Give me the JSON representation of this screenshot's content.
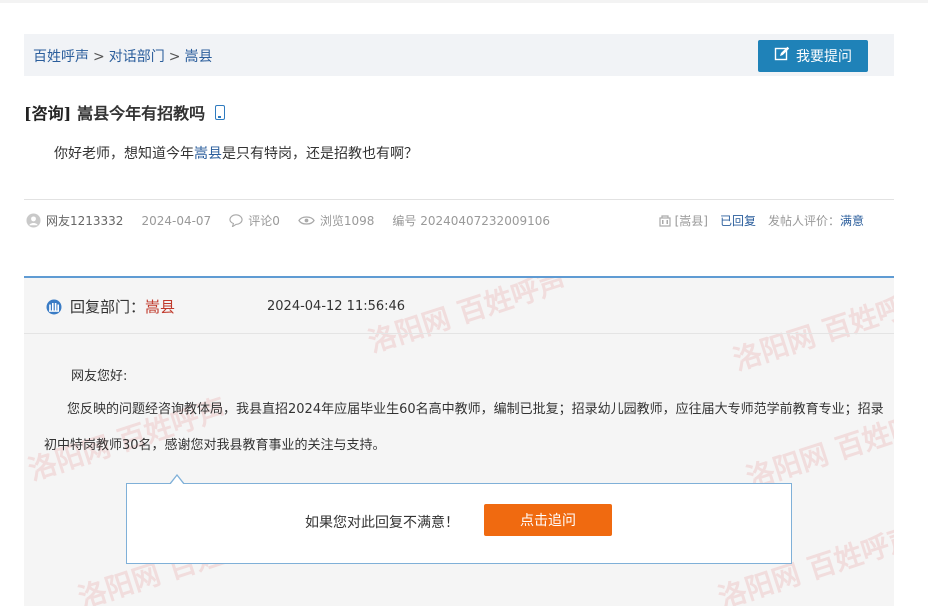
{
  "breadcrumb": {
    "home": "百姓呼声",
    "section": "对话部门",
    "current": "嵩县",
    "separator": ">"
  },
  "ask_button": {
    "label": "我要提问",
    "icon": "edit-icon"
  },
  "post": {
    "tag": "[咨询]",
    "title": "嵩县今年有招教吗",
    "body_before": "你好老师，想知道今年",
    "body_highlight": "嵩县",
    "body_after": "是只有特岗，还是招教也有啊？"
  },
  "meta": {
    "user": "网友1213332",
    "date": "2024-04-07",
    "comments": "评论0",
    "views": "浏览1098",
    "number": "编号 20240407232009106",
    "department": "[嵩县]",
    "status": "已回复",
    "rating_label": "发帖人评价：",
    "rating_value": "满意"
  },
  "reply": {
    "dept_label": "回复部门：",
    "dept_name": "嵩县",
    "time": "2024-04-12 11:56:46",
    "greeting": "网友您好:",
    "text": "您反映的问题经咨询教体局，我县直招2024年应届毕业生60名高中教师，编制已批复；招录幼儿园教师，应往届大专师范学前教育专业；招录初中特岗教师30名，感谢您对我县教育事业的关注与支持。",
    "watermark": "洛阳网 百姓呼声"
  },
  "followup": {
    "prompt": "如果您对此回复不满意！",
    "button": "点击追问"
  },
  "colors": {
    "link": "#2b5e9c",
    "primary_button": "#1f82b8",
    "followup_button": "#f06a10",
    "reply_border": "#5f9bd3",
    "dept_name": "#c0392b"
  }
}
